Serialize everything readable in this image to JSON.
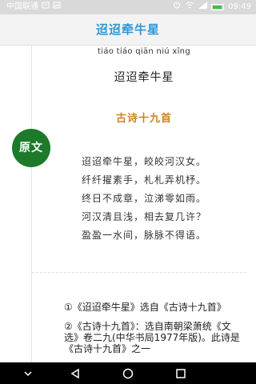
{
  "status_bar": {
    "carrier": "中国联通",
    "time": "09:49"
  },
  "header": {
    "title": "迢迢牵牛星"
  },
  "poem": {
    "pinyin": "tiáo tiáo qiān niú xīng",
    "title": "迢迢牵牛星",
    "source": "古诗十九首",
    "badge_label": "原文",
    "lines": [
      "迢迢牵牛星，皎皎河汉女。",
      "纤纤擢素手，札札弄机杼。",
      "终日不成章，泣涕零如雨。",
      "河汉清且浅，相去复几许？",
      "盈盈一水间，脉脉不得语。"
    ]
  },
  "notes": [
    "①《迢迢牵牛星》选自《古诗十九首》",
    "②《古诗十九首》：选自南朝梁萧统《文选》卷二九(中华书局1977年版)。此诗是《古诗十九首》之一"
  ],
  "nav": {
    "buttons": [
      "collapse-icon",
      "back-icon",
      "home-icon",
      "recents-icon"
    ]
  }
}
